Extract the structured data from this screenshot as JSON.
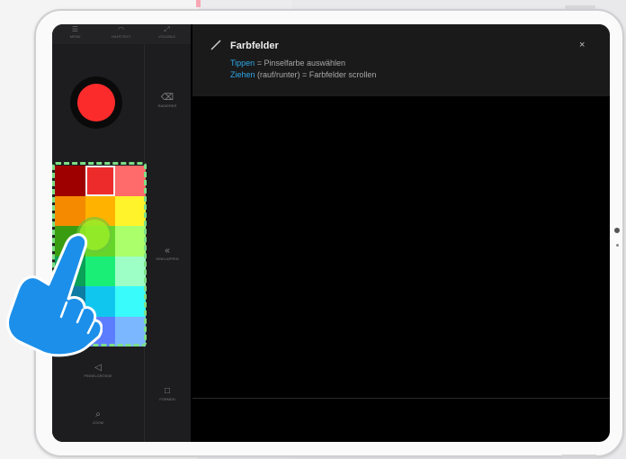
{
  "toolbar": {
    "items": [
      {
        "label": "MENÜ",
        "icon": "menu-icon"
      },
      {
        "label": "HILFETEXT",
        "icon": "wifi-icon"
      },
      {
        "label": "VOLLBILD",
        "icon": "fullscreen-icon"
      }
    ]
  },
  "sidebar": {
    "current_color": "#fc2b2b",
    "buttons": {
      "eraser": "RADIERER",
      "collapse": "EINKLAPPEN",
      "brush": "PINSELGRÖSSE",
      "shapes": "FORMEN",
      "zoom": "ZOOM"
    },
    "swatches": [
      [
        "#9e0000",
        "#ee2b2b",
        "#ff6a6a"
      ],
      [
        "#f58a00",
        "#ffb300",
        "#fff42b"
      ],
      [
        "#3a9d11",
        "#65d52a",
        "#aaff6b"
      ],
      [
        "#0aa058",
        "#1aee76",
        "#9dffc6"
      ],
      [
        "#0f7ca4",
        "#11c6ee",
        "#39fbfb"
      ],
      [
        "#1f4fc9",
        "#5d7dff",
        "#7ab7ff"
      ]
    ],
    "selected_swatch": "#ee2b2b"
  },
  "hint": {
    "title": "Farbfelder",
    "line1_keyword": "Tippen",
    "line1_text": " = Pinselfarbe auswählen",
    "line2_keyword": "Ziehen",
    "line2_text": " (rauf/runter) = Farbfelder scrollen",
    "close_symbol": "×"
  },
  "colors": {
    "accent": "#2ea8e8",
    "highlight_outline": "#7dde86",
    "hand_fill": "#1b8fea"
  }
}
